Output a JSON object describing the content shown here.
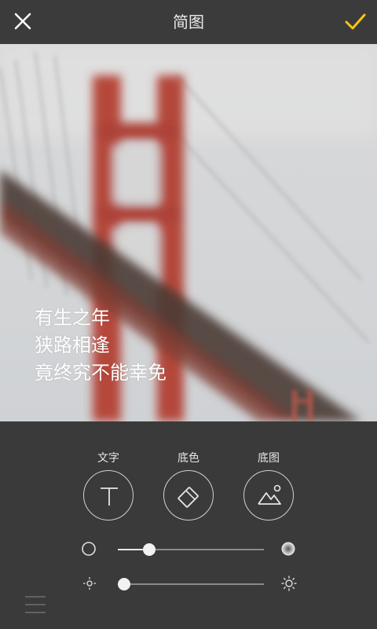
{
  "header": {
    "title": "简图",
    "close_icon": "close-icon",
    "confirm_icon": "checkmark-icon",
    "confirm_color": "#f5c518"
  },
  "canvas": {
    "lines": [
      "有生之年",
      "狭路相逢",
      "竟终究不能幸免"
    ],
    "text_color": "#ffffff",
    "image": "blurred golden gate bridge photo"
  },
  "tools": [
    {
      "label": "文字",
      "icon": "text-t-icon"
    },
    {
      "label": "底色",
      "icon": "paint-bucket-icon"
    },
    {
      "label": "底图",
      "icon": "mountain-image-icon"
    }
  ],
  "sliders": {
    "blur": {
      "level": 0.17,
      "left_icon": "circle-outline-icon",
      "right_icon": "blur-circle-icon"
    },
    "brightness": {
      "level": 0.0,
      "left_icon": "sun-small-icon",
      "right_icon": "sun-large-icon"
    }
  },
  "footer": {
    "menu_icon": "menu-lines-icon"
  }
}
